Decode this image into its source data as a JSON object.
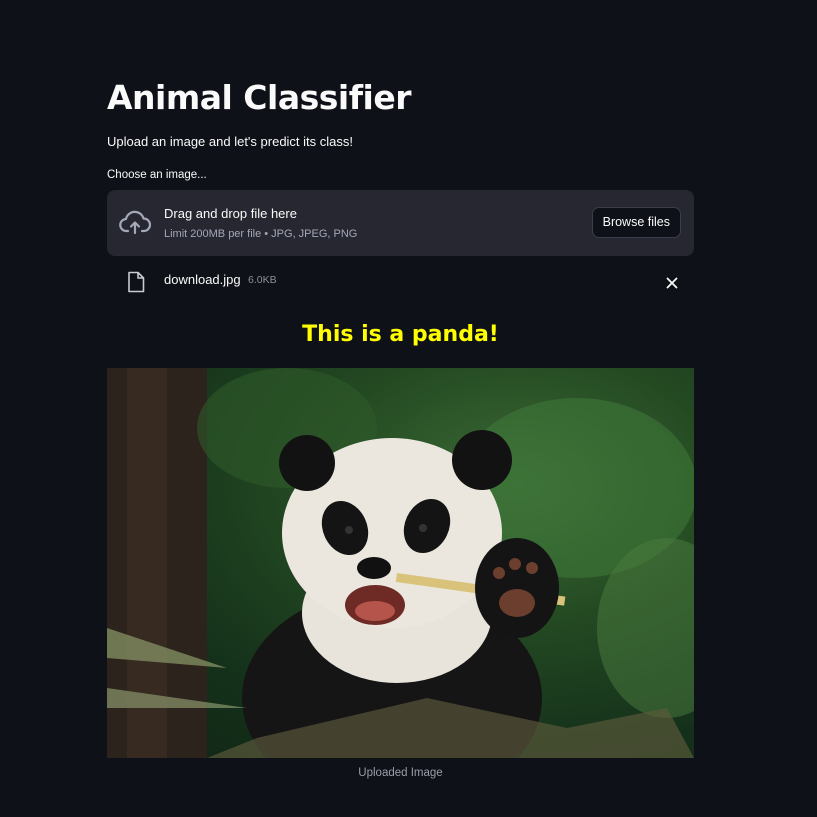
{
  "app": {
    "title": "Animal Classifier",
    "subtitle": "Upload an image and let's predict its class!"
  },
  "uploader": {
    "label": "Choose an image...",
    "drop_title": "Drag and drop file here",
    "limit_text": "Limit 200MB per file • JPG, JPEG, PNG",
    "browse_label": "Browse files",
    "cloud_icon": "cloud-upload-icon"
  },
  "file": {
    "name": "download.jpg",
    "size": "6.0KB",
    "file_icon": "file-icon",
    "remove_icon": "close-icon"
  },
  "result": {
    "text": "This is a panda!",
    "color": "#ffff00"
  },
  "image": {
    "caption": "Uploaded Image"
  },
  "colors": {
    "background": "#0e1117",
    "dropzone": "#262730",
    "text": "#fafafa"
  }
}
